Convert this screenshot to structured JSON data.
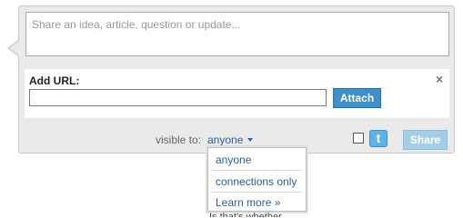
{
  "composer": {
    "placeholder": "Share an idea, article, question or update..."
  },
  "url_section": {
    "label": "Add URL:",
    "input_value": "",
    "attach_label": "Attach",
    "close_glyph": "×"
  },
  "footer": {
    "visible_label": "visible to:",
    "visible_value": "anyone",
    "twitter_glyph": "t",
    "share_label": "Share"
  },
  "dropdown": {
    "options": [
      "anyone",
      "connections only",
      "Learn more »"
    ]
  },
  "partial_text": "Is that's whether"
}
